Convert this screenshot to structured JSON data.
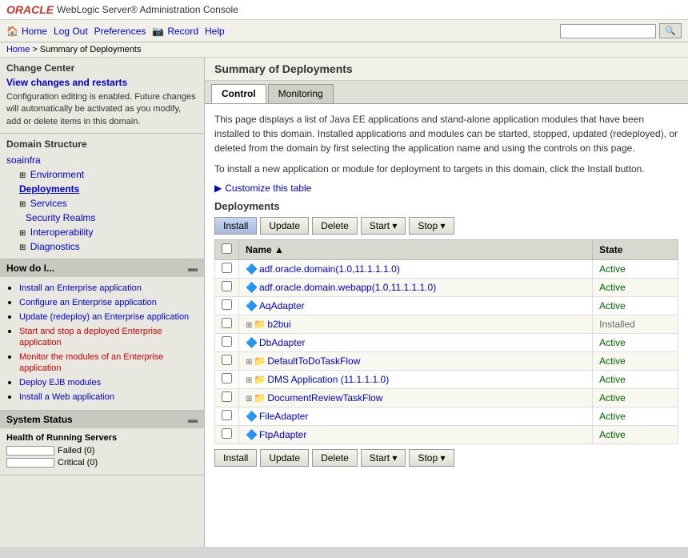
{
  "header": {
    "oracle_text": "ORACLE",
    "app_title": "WebLogic Server® Administration Console"
  },
  "top_nav": {
    "home_label": "Home",
    "logout_label": "Log Out",
    "preferences_label": "Preferences",
    "record_label": "Record",
    "help_label": "Help",
    "search_placeholder": ""
  },
  "breadcrumb": {
    "home_label": "Home",
    "separator": ">",
    "current_label": "Summary of Deployments"
  },
  "change_center": {
    "title": "Change Center",
    "link_label": "View changes and restarts",
    "description": "Configuration editing is enabled. Future changes will automatically be activated as you modify, add or delete items in this domain."
  },
  "domain_structure": {
    "title": "Domain Structure",
    "root_label": "soainfra",
    "items": [
      {
        "label": "Environment",
        "level": 1,
        "expandable": true
      },
      {
        "label": "Deployments",
        "level": 1,
        "selected": true
      },
      {
        "label": "Services",
        "level": 1,
        "expandable": true
      },
      {
        "label": "Security Realms",
        "level": 2
      },
      {
        "label": "Interoperability",
        "level": 1,
        "expandable": true
      },
      {
        "label": "Diagnostics",
        "level": 1,
        "expandable": true
      }
    ]
  },
  "how_do_i": {
    "title": "How do I...",
    "items": [
      {
        "label": "Install an Enterprise application"
      },
      {
        "label": "Configure an Enterprise application"
      },
      {
        "label": "Update (redeploy) an Enterprise application"
      },
      {
        "label": "Start and stop a deployed Enterprise application",
        "active": true
      },
      {
        "label": "Monitor the modules of an Enterprise application",
        "active": true
      },
      {
        "label": "Deploy EJB modules"
      },
      {
        "label": "Install a Web application"
      }
    ]
  },
  "system_status": {
    "title": "System Status",
    "subtitle": "Health of Running Servers",
    "items": [
      {
        "label": "Failed (0)",
        "value": 0
      },
      {
        "label": "Critical (0)",
        "value": 0
      }
    ]
  },
  "page": {
    "title": "Summary of Deployments",
    "tabs": [
      {
        "label": "Control",
        "active": true
      },
      {
        "label": "Monitoring",
        "active": false
      }
    ],
    "description_1": "This page displays a list of Java EE applications and stand-alone application modules that have been installed to this domain. Installed applications and modules can be started, stopped, updated (redeployed), or deleted from the domain by first selecting the application name and using the controls on this page.",
    "description_2": "To install a new application or module for deployment to targets in this domain, click the Install button.",
    "customize_label": "Customize this table",
    "deployments_title": "Deployments",
    "toolbar": {
      "install_label": "Install",
      "update_label": "Update",
      "delete_label": "Delete",
      "start_label": "Start",
      "stop_label": "Stop"
    },
    "table": {
      "columns": [
        "",
        "Name",
        "State"
      ],
      "rows": [
        {
          "name": "adf.oracle.domain(1.0,11.1.1.1.0)",
          "state": "Active",
          "expandable": false,
          "icon": "app"
        },
        {
          "name": "adf.oracle.domain.webapp(1.0,11.1.1.1.0)",
          "state": "Active",
          "expandable": false,
          "icon": "app"
        },
        {
          "name": "AqAdapter",
          "state": "Active",
          "expandable": false,
          "icon": "app"
        },
        {
          "name": "b2bui",
          "state": "Installed",
          "expandable": true,
          "icon": "folder"
        },
        {
          "name": "DbAdapter",
          "state": "Active",
          "expandable": false,
          "icon": "app"
        },
        {
          "name": "DefaultToDoTaskFlow",
          "state": "Active",
          "expandable": true,
          "icon": "folder"
        },
        {
          "name": "DMS Application (11.1.1.1.0)",
          "state": "Active",
          "expandable": true,
          "icon": "folder"
        },
        {
          "name": "DocumentReviewTaskFlow",
          "state": "Active",
          "expandable": true,
          "icon": "folder"
        },
        {
          "name": "FileAdapter",
          "state": "Active",
          "expandable": false,
          "icon": "app"
        },
        {
          "name": "FtpAdapter",
          "state": "Active",
          "expandable": false,
          "icon": "app"
        }
      ]
    }
  }
}
